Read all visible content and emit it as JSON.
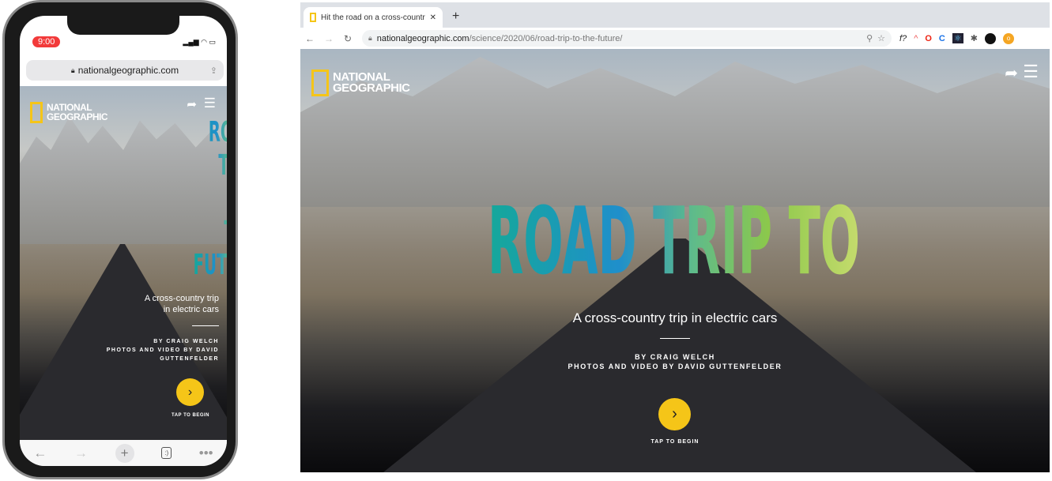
{
  "phone": {
    "time": "9:00",
    "url": "nationalgeographic.com",
    "logo": [
      "NATIONAL",
      "GEOGRAPHIC"
    ],
    "title_lines": [
      "ROAD",
      "TRIP TO",
      "THE",
      "FUTURE"
    ],
    "subtitle": "A cross-country trip in electric cars",
    "byline": "BY CRAIG WELCH",
    "credit": "PHOTOS AND VIDEO BY DAVID GUTTENFELDER",
    "cta": "TAP TO BEGIN",
    "tab_count_icon": ":)"
  },
  "browser": {
    "tab_title": "Hit the road on a cross-country",
    "url_domain": "nationalgeographic.com",
    "url_path": "/science/2020/06/road-trip-to-the-future/",
    "logo": [
      "NATIONAL",
      "GEOGRAPHIC"
    ],
    "title": "ROAD TRIP TO THE FUTURE",
    "subtitle": "A cross-country trip in electric cars",
    "byline": "BY CRAIG WELCH",
    "credit": "PHOTOS AND VIDEO BY DAVID GUTTENFELDER",
    "cta": "TAP TO BEGIN",
    "ext_f": "f?"
  },
  "colors": {
    "accent": "#f5c518",
    "time_badge": "#f23a3a"
  }
}
